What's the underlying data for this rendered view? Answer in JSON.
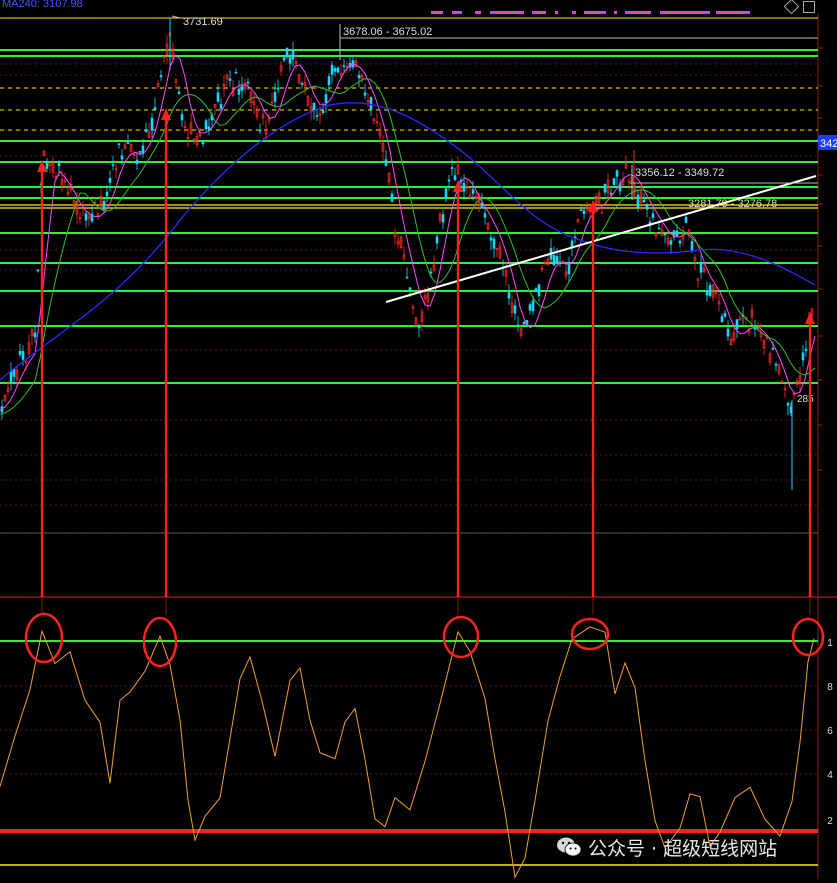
{
  "header": {
    "ma_label": "MA240: 3107.98"
  },
  "annotations": {
    "peak_label": "3731.69",
    "range1_label": "3678.06 - 3675.02",
    "range2_label": "3356.12 - 3349.72",
    "range3_label": "3281.79 - 3276.78",
    "right_price_tag": "342",
    "low_label": "285",
    "axis_value_label": "1"
  },
  "oscillator_axis": {
    "tick_labels": [
      "1",
      "8",
      "6",
      "4",
      "2"
    ]
  },
  "colors": {
    "background": "#000000",
    "horizontal_levels": "#33ee33",
    "candle_up": "#ff2a2a",
    "candle_down": "#19d6ff",
    "ma_short": "#ff44ff",
    "ma_mid": "#2fbf2f",
    "ma_long": "#2a2aff",
    "oscillator": "#f0a030",
    "markers": "#ff2020",
    "trendline": "#ffffff",
    "threshold_line": "#ff2020",
    "yellow_line": "#ffee00"
  },
  "watermark": {
    "icon": "wechat-icon",
    "text": "公众号 · 超级短线网站"
  },
  "chart_data": {
    "type": "line",
    "series": [
      {
        "name": "MA240",
        "values": [
          3107.98
        ]
      }
    ],
    "price_points": [
      3580,
      3620,
      3700,
      3731.69,
      3690,
      3678.06,
      3600,
      3500,
      3380,
      3356.12,
      3300,
      3281.79,
      3220,
      3190,
      3350,
      3300,
      3200,
      3100,
      2850
    ],
    "horizontal_levels": [
      "green solid",
      "yellow dashed",
      "green solid",
      "yellow solid",
      "green solid"
    ],
    "oscillator_peaks": [
      1,
      1,
      1,
      1,
      1
    ],
    "oscillator_threshold": "red horizontal line near 2",
    "signal_markers": 5,
    "legend": "top-left"
  }
}
